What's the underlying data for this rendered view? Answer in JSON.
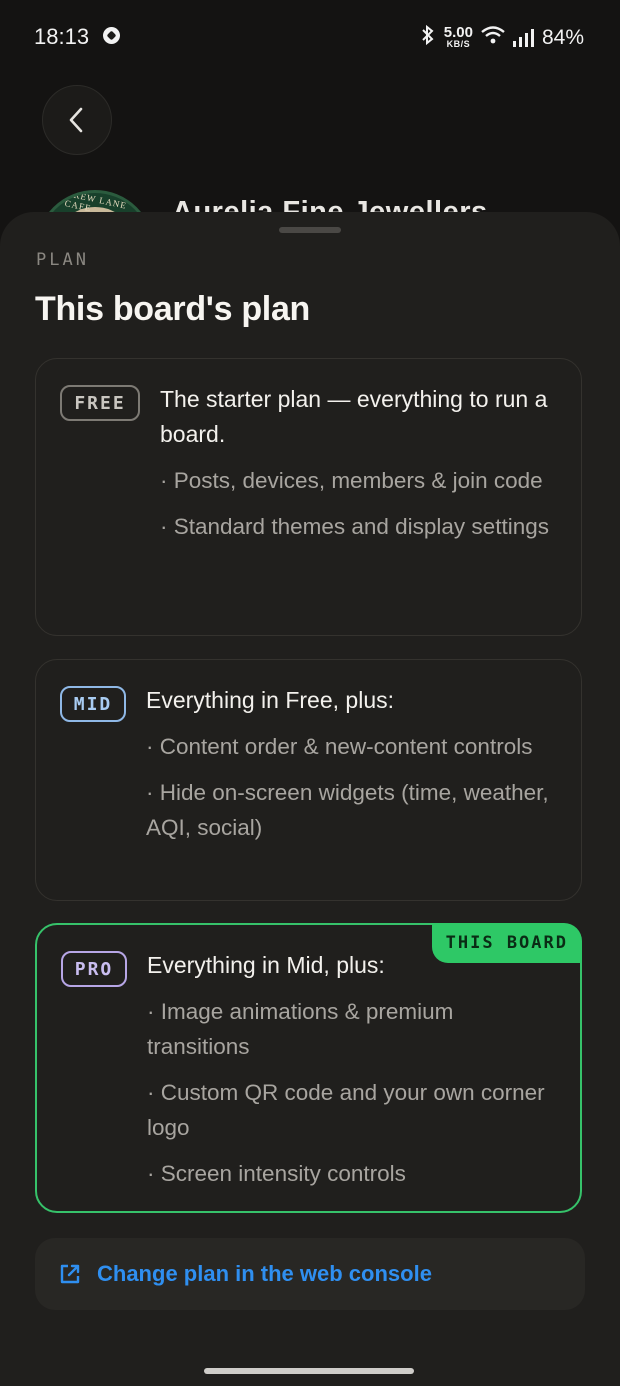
{
  "status_bar": {
    "time": "18:13",
    "net_speed_value": "5.00",
    "net_speed_unit": "KB/S",
    "battery": "84%"
  },
  "background": {
    "business_name": "Aurelia Fine Jewellers",
    "logo_text": "BREW LANE CAFE"
  },
  "sheet": {
    "section_label": "PLAN",
    "title": "This board's plan",
    "plans": [
      {
        "badge": "FREE",
        "headline": "The starter plan — everything to run a board.",
        "features": [
          "Posts, devices, members & join code",
          "Standard themes and display settings"
        ]
      },
      {
        "badge": "MID",
        "headline": "Everything in Free, plus:",
        "features": [
          "Content order & new-content controls",
          "Hide on-screen widgets (time, weather, AQI, social)"
        ]
      },
      {
        "badge": "PRO",
        "headline": "Everything in Mid, plus:",
        "current_label": "THIS BOARD",
        "features": [
          "Image animations & premium transitions",
          "Custom QR code and your own corner logo",
          "Screen intensity controls"
        ]
      }
    ],
    "web_console_label": "Change plan in the web console"
  },
  "colors": {
    "current_plan_accent": "#2ec866",
    "link_color": "#2f8ff0",
    "badge_mid": "#8fb8e6",
    "badge_pro": "#b7a6e6"
  }
}
